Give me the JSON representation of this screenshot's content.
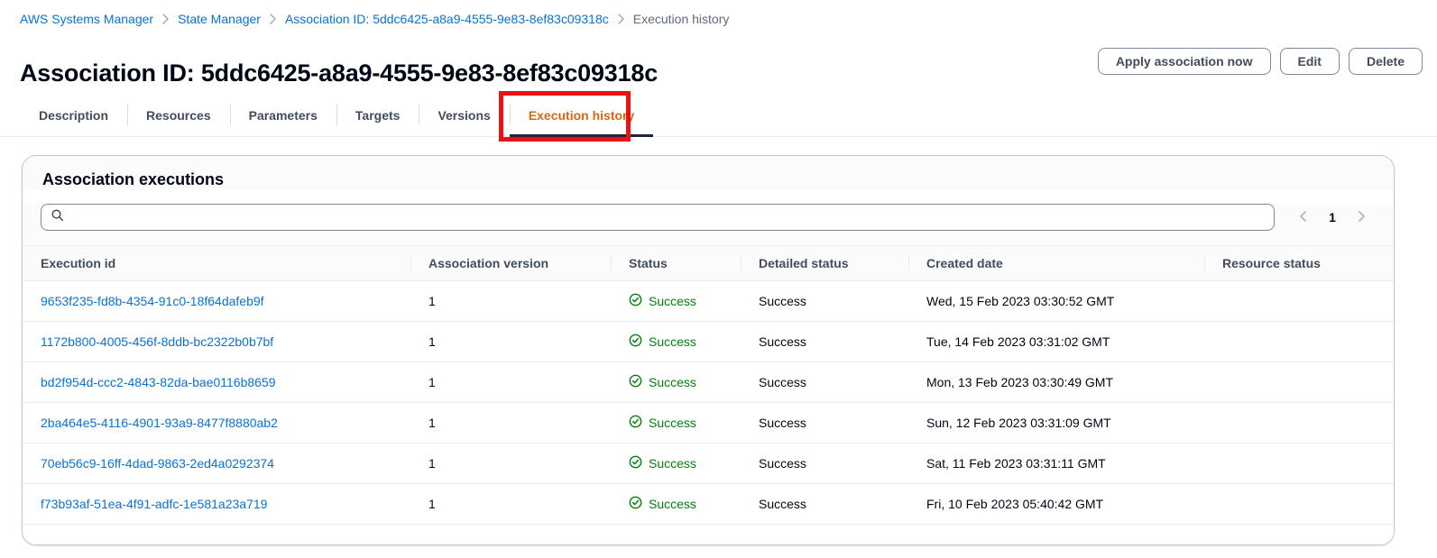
{
  "breadcrumb": {
    "items": [
      {
        "label": "AWS Systems Manager",
        "current": false
      },
      {
        "label": "State Manager",
        "current": false
      },
      {
        "label": "Association ID: 5ddc6425-a8a9-4555-9e83-8ef83c09318c",
        "current": false
      },
      {
        "label": "Execution history",
        "current": true
      }
    ]
  },
  "header": {
    "title": "Association ID: 5ddc6425-a8a9-4555-9e83-8ef83c09318c",
    "actions": [
      {
        "label": "Apply association now"
      },
      {
        "label": "Edit"
      },
      {
        "label": "Delete"
      }
    ]
  },
  "tabs": [
    {
      "label": "Description",
      "active": false
    },
    {
      "label": "Resources",
      "active": false
    },
    {
      "label": "Parameters",
      "active": false
    },
    {
      "label": "Targets",
      "active": false
    },
    {
      "label": "Versions",
      "active": false
    },
    {
      "label": "Execution history",
      "active": true
    }
  ],
  "annotation": {
    "shape": "rectangle",
    "color": "#ee1111",
    "target": "Execution history"
  },
  "panel": {
    "title": "Association executions",
    "search": {
      "value": "",
      "placeholder": ""
    },
    "pagination": {
      "prev": "‹",
      "page": "1",
      "next": "›"
    }
  },
  "table": {
    "columns": [
      "Execution id",
      "Association version",
      "Status",
      "Detailed status",
      "Created date",
      "Resource status"
    ],
    "rows": [
      {
        "execution_id": "9653f235-fd8b-4354-91c0-18f64dafeb9f",
        "association_version": "1",
        "status": "Success",
        "detailed_status": "Success",
        "created_date": "Wed, 15 Feb 2023 03:30:52 GMT",
        "resource_status": ""
      },
      {
        "execution_id": "1172b800-4005-456f-8ddb-bc2322b0b7bf",
        "association_version": "1",
        "status": "Success",
        "detailed_status": "Success",
        "created_date": "Tue, 14 Feb 2023 03:31:02 GMT",
        "resource_status": ""
      },
      {
        "execution_id": "bd2f954d-ccc2-4843-82da-bae0116b8659",
        "association_version": "1",
        "status": "Success",
        "detailed_status": "Success",
        "created_date": "Mon, 13 Feb 2023 03:30:49 GMT",
        "resource_status": ""
      },
      {
        "execution_id": "2ba464e5-4116-4901-93a9-8477f8880ab2",
        "association_version": "1",
        "status": "Success",
        "detailed_status": "Success",
        "created_date": "Sun, 12 Feb 2023 03:31:09 GMT",
        "resource_status": ""
      },
      {
        "execution_id": "70eb56c9-16ff-4dad-9863-2ed4a0292374",
        "association_version": "1",
        "status": "Success",
        "detailed_status": "Success",
        "created_date": "Sat, 11 Feb 2023 03:31:11 GMT",
        "resource_status": ""
      },
      {
        "execution_id": "f73b93af-51ea-4f91-adfc-1e581a23a719",
        "association_version": "1",
        "status": "Success",
        "detailed_status": "Success",
        "created_date": "Fri, 10 Feb 2023 05:40:42 GMT",
        "resource_status": ""
      }
    ]
  },
  "icons": {
    "search": "search-icon",
    "success": "success-check-circle-icon",
    "chevron_right": "chevron-right-icon",
    "chevron_left": "chevron-left-icon"
  },
  "colors": {
    "link": "#0972d3",
    "active_tab": "#d86613",
    "success": "#037f0c",
    "annotation": "#ee1111",
    "text": "#000716",
    "muted": "#5f6b7a"
  }
}
